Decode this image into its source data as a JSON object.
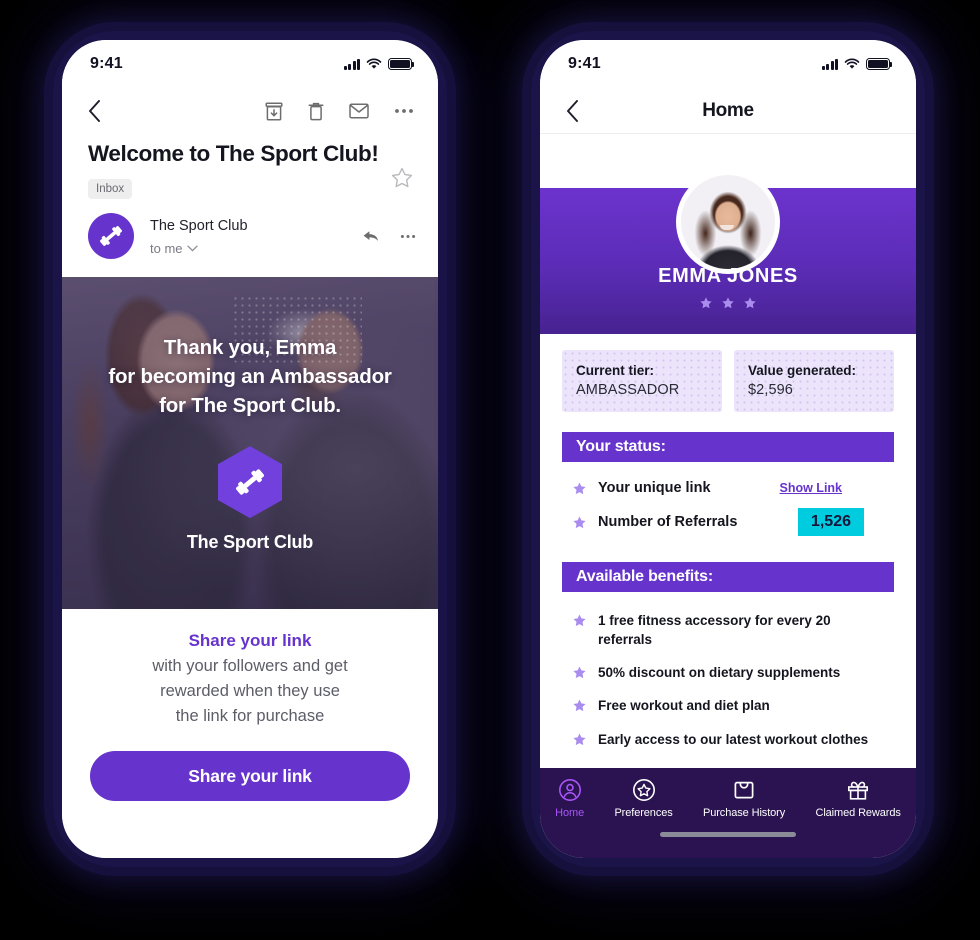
{
  "left_phone": {
    "status_bar": {
      "time": "9:41",
      "signal_icon": "cellular-bars-icon",
      "wifi_icon": "wifi-icon",
      "battery_icon": "battery-full-icon"
    },
    "toolbar": {
      "back_icon": "back-chevron-icon",
      "archive_icon": "archive-icon",
      "delete_icon": "trash-icon",
      "mark_unread_icon": "envelope-icon",
      "more_icon": "more-options-icon"
    },
    "mail": {
      "subject": "Welcome to The Sport Club!",
      "star_icon": "star-outline-icon",
      "label": "Inbox",
      "sender_name": "The Sport Club",
      "recipient": "to me",
      "recipient_chevron_icon": "chevron-down-icon",
      "reply_icon": "reply-arrow-icon",
      "more_icon": "more-options-icon",
      "sender_avatar_icon": "dumbbell-icon"
    },
    "hero": {
      "line1": "Thank you, Emma",
      "line2": "for becoming an Ambassador",
      "line3": "for The Sport Club.",
      "logo_icon": "dumbbell-hexagon-logo-icon",
      "brand": "The Sport Club"
    },
    "cta": {
      "lead": "Share your link",
      "sub_line1": "with your followers and get",
      "sub_line2": "rewarded when they use",
      "sub_line3": "the link for purchase",
      "button_label": "Share your link"
    }
  },
  "right_phone": {
    "status_bar": {
      "time": "9:41",
      "signal_icon": "cellular-bars-icon",
      "wifi_icon": "wifi-icon",
      "battery_icon": "battery-full-icon"
    },
    "header": {
      "back_icon": "back-chevron-icon",
      "title": "Home"
    },
    "profile": {
      "avatar_icon": "user-photo-avatar",
      "name": "EMMA JONES",
      "stars": [
        "star-icon",
        "star-icon",
        "star-icon"
      ]
    },
    "tier_cards": [
      {
        "label": "Current tier:",
        "value": "AMBASSADOR"
      },
      {
        "label": "Value generated:",
        "value": "$2,596"
      }
    ],
    "status_section": {
      "title": "Your status:",
      "items": [
        {
          "bullet_icon": "star-bullet-icon",
          "label": "Your unique link",
          "action": "Show Link"
        },
        {
          "bullet_icon": "star-bullet-icon",
          "label": "Number of Referrals",
          "badge": "1,526"
        }
      ]
    },
    "benefits_section": {
      "title": "Available benefits:",
      "items": [
        {
          "bullet_icon": "star-bullet-icon",
          "text": "1 free fitness accessory for every 20 referrals"
        },
        {
          "bullet_icon": "star-bullet-icon",
          "text": "50% discount on dietary supplements"
        },
        {
          "bullet_icon": "star-bullet-icon",
          "text": "Free workout and diet plan"
        },
        {
          "bullet_icon": "star-bullet-icon",
          "text": "Early access to our latest workout clothes"
        }
      ]
    },
    "tabbar": {
      "tabs": [
        {
          "label": "Home",
          "icon": "user-circle-icon",
          "active": true
        },
        {
          "label": "Preferences",
          "icon": "star-circle-icon",
          "active": false
        },
        {
          "label": "Purchase History",
          "icon": "shopping-bag-icon",
          "active": false
        },
        {
          "label": "Claimed Rewards",
          "icon": "gift-icon",
          "active": false
        }
      ]
    }
  },
  "colors": {
    "brand_purple": "#6634CC",
    "hex_purple": "#7140DD",
    "cyan_badge": "#00CCDF",
    "lavender_card": "#ECE4FB",
    "star_lavender": "#A98CEE",
    "tabbar_bg": "#2A1350",
    "tab_active": "#A855F7",
    "phone_frame": "#171140",
    "page_bg": "#000000"
  }
}
